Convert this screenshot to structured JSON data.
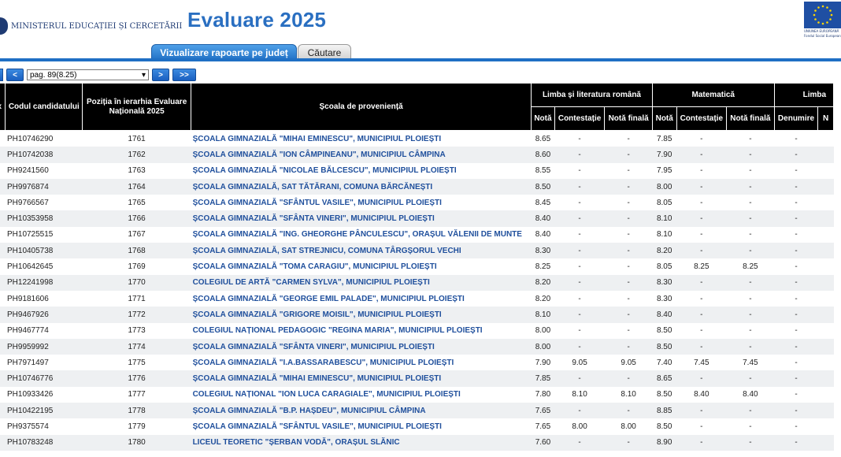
{
  "header": {
    "ministry": "MINISTERUL EDUCAȚIEI ȘI CERCETĂRII",
    "title": "Evaluare 2025",
    "eu_caption_1": "UNIUNEA EUROPEANĂ",
    "eu_caption_2": "Fondul Social European"
  },
  "tabs": [
    {
      "label": "Vizualizare rapoarte pe județ"
    },
    {
      "label": "Căutare"
    }
  ],
  "pager": {
    "first": "<",
    "prev": "<",
    "select": "pag. 89(8.25)",
    "next": ">",
    "last": ">>"
  },
  "table": {
    "group_headers": {
      "x": "x",
      "code": "Codul candidatului",
      "position": "Poziția în ierarhia Evaluare Națională 2025",
      "school": "Școala de proveniență",
      "romana": "Limba și literatura română",
      "mate": "Matematică",
      "limba": "Limba"
    },
    "sub_headers": {
      "nota": "Notă",
      "contestatie": "Contestație",
      "nota_finala": "Notă finală",
      "denumire": "Denumire",
      "n": "N"
    },
    "rows": [
      {
        "code": "PH10746290",
        "pos": "1761",
        "school": "ȘCOALA GIMNAZIALĂ \"MIHAI EMINESCU\", MUNICIPIUL PLOIEȘTI",
        "r_nota": "8.65",
        "r_cont": "-",
        "r_fin": "-",
        "m_nota": "7.85",
        "m_cont": "-",
        "m_fin": "-",
        "den": "-"
      },
      {
        "code": "PH10742038",
        "pos": "1762",
        "school": "ȘCOALA GIMNAZIALĂ \"ION CÂMPINEANU\", MUNICIPIUL CÂMPINA",
        "r_nota": "8.60",
        "r_cont": "-",
        "r_fin": "-",
        "m_nota": "7.90",
        "m_cont": "-",
        "m_fin": "-",
        "den": "-"
      },
      {
        "code": "PH9241560",
        "pos": "1763",
        "school": "ȘCOALA GIMNAZIALĂ \"NICOLAE BĂLCESCU\", MUNICIPIUL PLOIEȘTI",
        "r_nota": "8.55",
        "r_cont": "-",
        "r_fin": "-",
        "m_nota": "7.95",
        "m_cont": "-",
        "m_fin": "-",
        "den": "-"
      },
      {
        "code": "PH9976874",
        "pos": "1764",
        "school": "ȘCOALA GIMNAZIALĂ, SAT TĂTĂRANI, COMUNA BĂRCĂNEȘTI",
        "r_nota": "8.50",
        "r_cont": "-",
        "r_fin": "-",
        "m_nota": "8.00",
        "m_cont": "-",
        "m_fin": "-",
        "den": "-"
      },
      {
        "code": "PH9766567",
        "pos": "1765",
        "school": "ȘCOALA GIMNAZIALĂ \"SFÂNTUL VASILE\", MUNICIPIUL PLOIEȘTI",
        "r_nota": "8.45",
        "r_cont": "-",
        "r_fin": "-",
        "m_nota": "8.05",
        "m_cont": "-",
        "m_fin": "-",
        "den": "-"
      },
      {
        "code": "PH10353958",
        "pos": "1766",
        "school": "ȘCOALA GIMNAZIALĂ \"SFÂNTA VINERI\", MUNICIPIUL PLOIEȘTI",
        "r_nota": "8.40",
        "r_cont": "-",
        "r_fin": "-",
        "m_nota": "8.10",
        "m_cont": "-",
        "m_fin": "-",
        "den": "-"
      },
      {
        "code": "PH10725515",
        "pos": "1767",
        "school": "ȘCOALA GIMNAZIALĂ \"ING. GHEORGHE PÂNCULESCU\", ORAȘUL VĂLENII DE MUNTE",
        "r_nota": "8.40",
        "r_cont": "-",
        "r_fin": "-",
        "m_nota": "8.10",
        "m_cont": "-",
        "m_fin": "-",
        "den": "-"
      },
      {
        "code": "PH10405738",
        "pos": "1768",
        "school": "ȘCOALA GIMNAZIALĂ, SAT STREJNICU, COMUNA TÂRGȘORUL VECHI",
        "r_nota": "8.30",
        "r_cont": "-",
        "r_fin": "-",
        "m_nota": "8.20",
        "m_cont": "-",
        "m_fin": "-",
        "den": "-"
      },
      {
        "code": "PH10642645",
        "pos": "1769",
        "school": "ȘCOALA GIMNAZIALĂ \"TOMA CARAGIU\", MUNICIPIUL PLOIEȘTI",
        "r_nota": "8.25",
        "r_cont": "-",
        "r_fin": "-",
        "m_nota": "8.05",
        "m_cont": "8.25",
        "m_fin": "8.25",
        "den": "-"
      },
      {
        "code": "PH12241998",
        "pos": "1770",
        "school": "COLEGIUL DE ARTĂ \"CARMEN SYLVA\", MUNICIPIUL PLOIEȘTI",
        "r_nota": "8.20",
        "r_cont": "-",
        "r_fin": "-",
        "m_nota": "8.30",
        "m_cont": "-",
        "m_fin": "-",
        "den": "-"
      },
      {
        "code": "PH9181606",
        "pos": "1771",
        "school": "ȘCOALA GIMNAZIALĂ \"GEORGE EMIL PALADE\", MUNICIPIUL PLOIEȘTI",
        "r_nota": "8.20",
        "r_cont": "-",
        "r_fin": "-",
        "m_nota": "8.30",
        "m_cont": "-",
        "m_fin": "-",
        "den": "-"
      },
      {
        "code": "PH9467926",
        "pos": "1772",
        "school": "ȘCOALA GIMNAZIALĂ \"GRIGORE MOISIL\", MUNICIPIUL PLOIEȘTI",
        "r_nota": "8.10",
        "r_cont": "-",
        "r_fin": "-",
        "m_nota": "8.40",
        "m_cont": "-",
        "m_fin": "-",
        "den": "-"
      },
      {
        "code": "PH9467774",
        "pos": "1773",
        "school": "COLEGIUL NAȚIONAL PEDAGOGIC \"REGINA MARIA\", MUNICIPIUL PLOIEȘTI",
        "r_nota": "8.00",
        "r_cont": "-",
        "r_fin": "-",
        "m_nota": "8.50",
        "m_cont": "-",
        "m_fin": "-",
        "den": "-"
      },
      {
        "code": "PH9959992",
        "pos": "1774",
        "school": "ȘCOALA GIMNAZIALĂ \"SFÂNTA VINERI\", MUNICIPIUL PLOIEȘTI",
        "r_nota": "8.00",
        "r_cont": "-",
        "r_fin": "-",
        "m_nota": "8.50",
        "m_cont": "-",
        "m_fin": "-",
        "den": "-"
      },
      {
        "code": "PH7971497",
        "pos": "1775",
        "school": "ȘCOALA GIMNAZIALĂ \"I.A.BASSARABESCU\", MUNICIPIUL PLOIEȘTI",
        "r_nota": "7.90",
        "r_cont": "9.05",
        "r_fin": "9.05",
        "m_nota": "7.40",
        "m_cont": "7.45",
        "m_fin": "7.45",
        "den": "-"
      },
      {
        "code": "PH10746776",
        "pos": "1776",
        "school": "ȘCOALA GIMNAZIALĂ \"MIHAI EMINESCU\", MUNICIPIUL PLOIEȘTI",
        "r_nota": "7.85",
        "r_cont": "-",
        "r_fin": "-",
        "m_nota": "8.65",
        "m_cont": "-",
        "m_fin": "-",
        "den": "-"
      },
      {
        "code": "PH10933426",
        "pos": "1777",
        "school": "COLEGIUL NAȚIONAL \"ION LUCA CARAGIALE\", MUNICIPIUL PLOIEȘTI",
        "r_nota": "7.80",
        "r_cont": "8.10",
        "r_fin": "8.10",
        "m_nota": "8.50",
        "m_cont": "8.40",
        "m_fin": "8.40",
        "den": "-"
      },
      {
        "code": "PH10422195",
        "pos": "1778",
        "school": "ȘCOALA GIMNAZIALĂ \"B.P. HAȘDEU\", MUNICIPIUL CÂMPINA",
        "r_nota": "7.65",
        "r_cont": "-",
        "r_fin": "-",
        "m_nota": "8.85",
        "m_cont": "-",
        "m_fin": "-",
        "den": "-"
      },
      {
        "code": "PH9375574",
        "pos": "1779",
        "school": "ȘCOALA GIMNAZIALĂ \"SFÂNTUL VASILE\", MUNICIPIUL PLOIEȘTI",
        "r_nota": "7.65",
        "r_cont": "8.00",
        "r_fin": "8.00",
        "m_nota": "8.50",
        "m_cont": "-",
        "m_fin": "-",
        "den": "-"
      },
      {
        "code": "PH10783248",
        "pos": "1780",
        "school": "LICEUL TEORETIC \"ȘERBAN VODĂ\", ORAȘUL SLĂNIC",
        "r_nota": "7.60",
        "r_cont": "-",
        "r_fin": "-",
        "m_nota": "8.90",
        "m_cont": "-",
        "m_fin": "-",
        "den": "-"
      }
    ]
  },
  "colors": {
    "accent": "#1f6fc4",
    "title": "#2a6fc1",
    "link": "#1f4f9c",
    "header_bg": "#000000"
  }
}
